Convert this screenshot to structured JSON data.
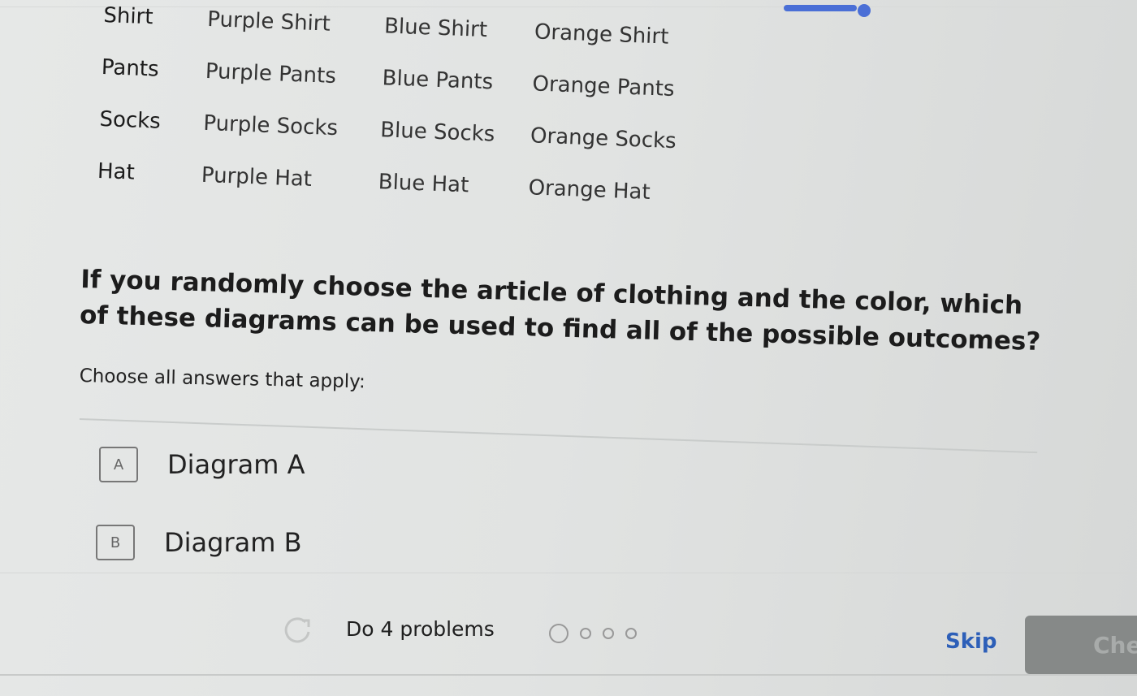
{
  "progress": {
    "fraction": 0.9
  },
  "table": {
    "rows": [
      {
        "item": "Shirt",
        "cells": [
          "Purple Shirt",
          "Blue Shirt",
          "Orange Shirt"
        ]
      },
      {
        "item": "Pants",
        "cells": [
          "Purple Pants",
          "Blue Pants",
          "Orange Pants"
        ]
      },
      {
        "item": "Socks",
        "cells": [
          "Purple Socks",
          "Blue Socks",
          "Orange Socks"
        ]
      },
      {
        "item": "Hat",
        "cells": [
          "Purple Hat",
          "Blue Hat",
          "Orange Hat"
        ]
      }
    ]
  },
  "question": {
    "text": "If you randomly choose the article of clothing and the color, which of these diagrams can be used to find all of the possible outcomes?",
    "instruction": "Choose all answers that apply:"
  },
  "choices": [
    {
      "letter": "A",
      "label": "Diagram A"
    },
    {
      "letter": "B",
      "label": "Diagram B"
    }
  ],
  "footer": {
    "task_label": "Do 4 problems",
    "problems_total": 4,
    "problems_done": 0,
    "skip_label": "Skip",
    "check_label": "Check"
  },
  "colors": {
    "accent": "#4a6fd6",
    "link": "#2d5fb8",
    "button_disabled": "#868988"
  }
}
